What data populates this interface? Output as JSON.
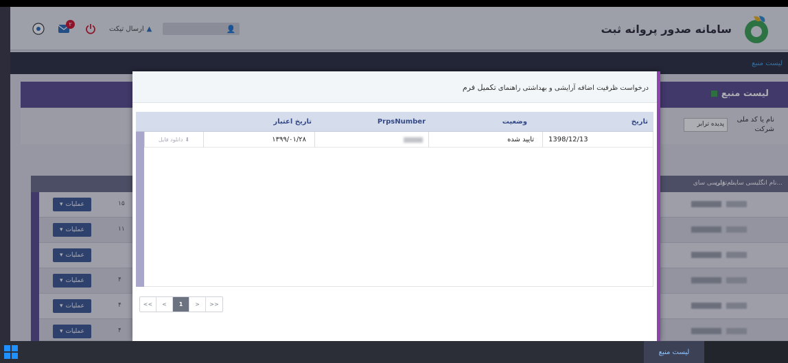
{
  "header": {
    "brand_title": "سامانه صدور پروانه ثبت",
    "send_ticket": "ارسال تیکت",
    "notification_count": "۲"
  },
  "breadcrumb": "لیست منبع",
  "panel": {
    "title": "لیست منبع",
    "filter_label": "نام یا کد ملی شرکت",
    "filter_select": "پدیده ترابر"
  },
  "table": {
    "headers": [
      "نام انگلیسی سایت تولی...",
      "نام فارسی سای"
    ],
    "rows": [
      {
        "ops": "عملیات",
        "num": "۱۵"
      },
      {
        "ops": "عملیات",
        "num": "۱۱"
      },
      {
        "ops": "عملیات",
        "num": ""
      },
      {
        "ops": "عملیات",
        "num": "۴"
      },
      {
        "ops": "عملیات",
        "num": "۴"
      },
      {
        "ops": "عملیات",
        "num": "۴"
      }
    ]
  },
  "modal": {
    "title_prefix": "درخواست ظرفیت اضافه آرایشی و بهداشتی راهنمای ",
    "title_main": "تکمیل فرم",
    "columns": {
      "date": "تاریخ",
      "status": "وضعیت",
      "prps": "PrpsNumber",
      "validity": "تاریخ اعتبار"
    },
    "rows": [
      {
        "date": "1398/12/13",
        "status": "تایید شده",
        "validity": "۱۳۹۹/۰۱/۲۸",
        "download": "دانلود فایل"
      }
    ],
    "pager": [
      "<<",
      "<",
      "1",
      ">",
      ">>"
    ]
  },
  "taskbar": {
    "active_item": "لیست منبع"
  }
}
